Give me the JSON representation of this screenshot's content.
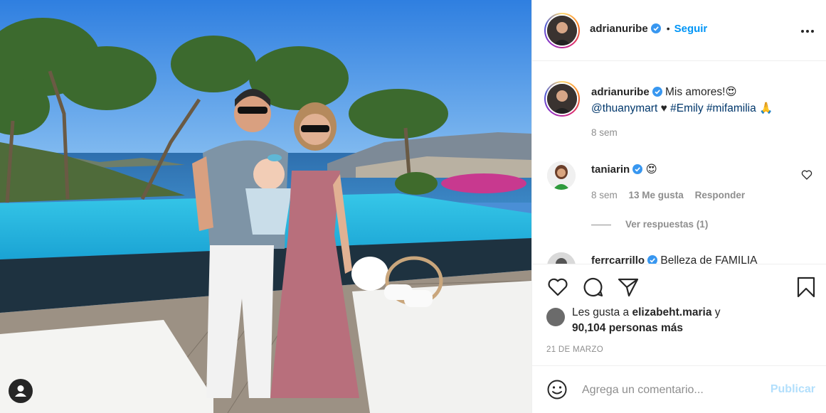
{
  "post": {
    "photo": {
      "description_icon": "user-tag-icon"
    },
    "author": {
      "username": "adrianuribe",
      "verified": true,
      "follow_label": "Seguir",
      "separator": "•"
    },
    "caption": {
      "username": "adrianuribe",
      "text": "Mis amores!",
      "emoji": "😍",
      "mention": "@thuanymart",
      "heart": "♥",
      "hashtag1": "#Emily",
      "hashtag2": "#mifamilia",
      "pray": "🙏",
      "time": "8 sem"
    },
    "comments": [
      {
        "username": "taniarin",
        "verified": true,
        "text": "😍",
        "time": "8 sem",
        "likes": "13 Me gusta",
        "reply_label": "Responder",
        "view_replies": "Ver respuestas (1)"
      },
      {
        "username": "ferrcarrillo",
        "verified": true,
        "text": "Belleza de FAMILIA"
      }
    ],
    "likes": {
      "prefix": "Les gusta a",
      "user": "elizabeht.maria",
      "joiner": "y",
      "others": "90,104 personas más"
    },
    "date": "21 DE MARZO",
    "add_comment": {
      "placeholder": "Agrega un comentario...",
      "publish_label": "Publicar"
    }
  },
  "colors": {
    "accent": "#0095f6",
    "verified": "#3897f0",
    "publish_disabled": "#b2dffc",
    "text": "#262626",
    "secondary": "#8e8e8e"
  }
}
